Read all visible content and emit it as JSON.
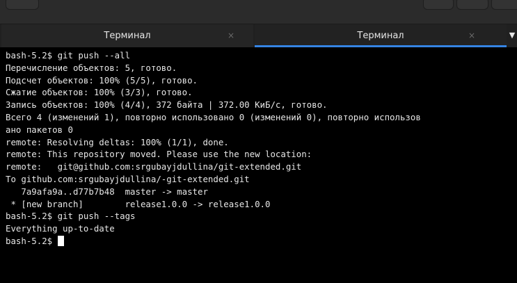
{
  "tabs": [
    {
      "label": "Терминал",
      "active": false
    },
    {
      "label": "Терминал",
      "active": true
    }
  ],
  "colors": {
    "tab_accent": "#3584e4",
    "terminal_bg": "#000000",
    "terminal_fg": "#e6e6e6"
  },
  "icons": {
    "tab_close": "close-icon",
    "tab_menu": "chevron-down-icon"
  },
  "glyphs": {
    "close": "×",
    "menu": "▼"
  },
  "terminal": {
    "lines": [
      "bash-5.2$ git push --all",
      "Перечисление объектов: 5, готово.",
      "Подсчет объектов: 100% (5/5), готово.",
      "Сжатие объектов: 100% (3/3), готово.",
      "Запись объектов: 100% (4/4), 372 байта | 372.00 КиБ/с, готово.",
      "Всего 4 (изменений 1), повторно использовано 0 (изменений 0), повторно использов",
      "ано пакетов 0",
      "remote: Resolving deltas: 100% (1/1), done.",
      "remote: This repository moved. Please use the new location:",
      "remote:   git@github.com:srgubayjdullina/git-extended.git",
      "To github.com:srgubayjdullina/-git-extended.git",
      "   7a9afa9a..d77b7b48  master -> master",
      " * [new branch]        release1.0.0 -> release1.0.0",
      "bash-5.2$ git push --tags",
      "Everything up-to-date"
    ],
    "prompt": "bash-5.2$ "
  }
}
